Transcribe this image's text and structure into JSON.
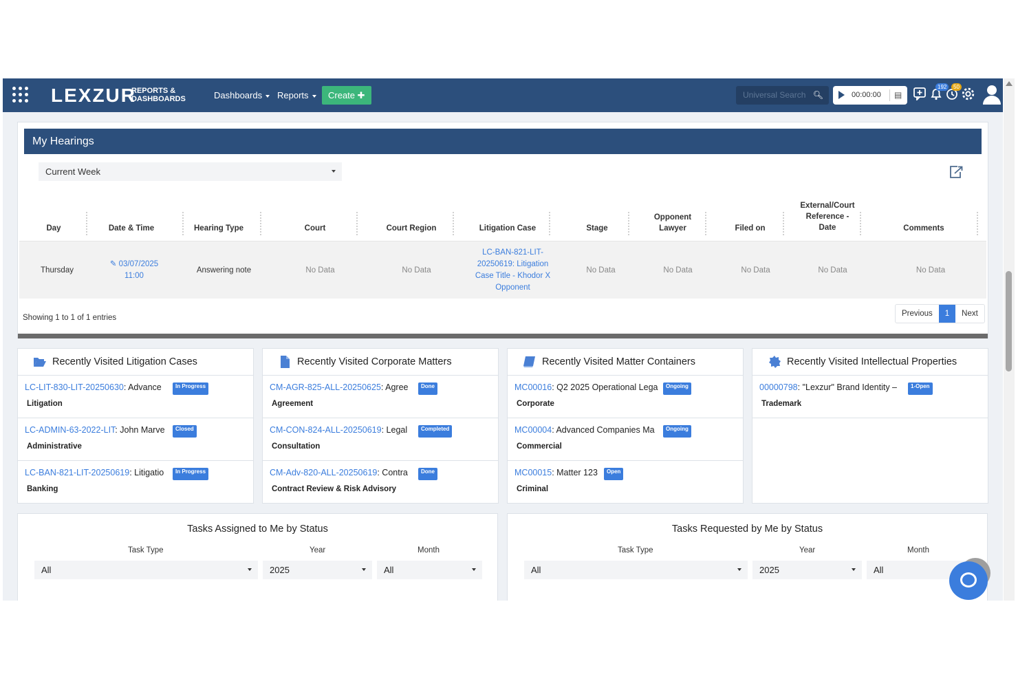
{
  "navbar": {
    "logo": "LEXZUR",
    "logo_sub_1": "REPORTS &",
    "logo_sub_2": "DASHBOARDS",
    "menu": [
      "Dashboards",
      "Reports"
    ],
    "create_label": "Create",
    "search_placeholder": "Universal Search",
    "timer": "00:00:00",
    "notifications_badge": "192",
    "reminders_badge": "50",
    "badge_colors": {
      "notifications": "#3b7ddd",
      "reminders": "#e6a817"
    }
  },
  "hearings": {
    "title": "My Hearings",
    "period": "Current Week",
    "columns": [
      "Day",
      "Date & Time",
      "Hearing Type",
      "Court",
      "Court Region",
      "Litigation Case",
      "Stage",
      "Opponent Lawyer",
      "Filed on",
      "External/Court Reference - Date",
      "Comments"
    ],
    "rows": [
      {
        "day": "Thursday",
        "date_time": "03/07/2025 11:00",
        "hearing_type": "Answering note",
        "court": "No Data",
        "court_region": "No Data",
        "litigation_case": "LC-BAN-821-LIT-20250619: Litigation Case Title - Khodor X Opponent",
        "stage": "No Data",
        "opponent_lawyer": "No Data",
        "filed_on": "No Data",
        "external_ref": "No Data",
        "comments": "No Data"
      }
    ],
    "showing": "Showing 1 to 1 of 1 entries",
    "pager": {
      "previous": "Previous",
      "current": "1",
      "next": "Next"
    }
  },
  "recent": [
    {
      "title": "Recently Visited Litigation Cases",
      "icon": "folder-open-icon",
      "items": [
        {
          "code": "LC-LIT-830-LIT-20250630",
          "text": ": Advance",
          "status": "In Progress",
          "category": "Litigation"
        },
        {
          "code": "LC-ADMIN-63-2022-LIT",
          "text": ": John Marve",
          "status": "Closed",
          "category": "Administrative"
        },
        {
          "code": "LC-BAN-821-LIT-20250619",
          "text": ": Litigatio",
          "status": "In Progress",
          "category": "Banking"
        }
      ]
    },
    {
      "title": "Recently Visited Corporate Matters",
      "icon": "file-icon",
      "items": [
        {
          "code": "CM-AGR-825-ALL-20250625",
          "text": ": Agree",
          "status": "Done",
          "category": "Agreement"
        },
        {
          "code": "CM-CON-824-ALL-20250619",
          "text": ": Legal",
          "status": "Completed",
          "category": "Consultation"
        },
        {
          "code": "CM-Adv-820-ALL-20250619",
          "text": ": Contra",
          "status": "Done",
          "category": "Contract Review & Risk Advisory"
        }
      ]
    },
    {
      "title": "Recently Visited Matter Containers",
      "icon": "book-icon",
      "items": [
        {
          "code": "MC00016",
          "text": ": Q2 2025 Operational Lega",
          "status": "Ongoing",
          "category": "Corporate"
        },
        {
          "code": "MC00004",
          "text": ": Advanced Companies Ma",
          "status": "Ongoing",
          "category": "Commercial"
        },
        {
          "code": "MC00015",
          "text": ": Matter 123",
          "status": "Open",
          "category": "Criminal"
        }
      ]
    },
    {
      "title": "Recently Visited Intellectual Properties",
      "icon": "badge-certificate-icon",
      "items": [
        {
          "code": "00000798",
          "text": ": \"Lexzur\" Brand Identity –",
          "status": "1-Open",
          "category": "Trademark"
        }
      ]
    }
  ],
  "tasks": [
    {
      "title": "Tasks Assigned to Me by Status",
      "labels": {
        "task_type": "Task Type",
        "year": "Year",
        "month": "Month"
      },
      "values": {
        "task_type": "All",
        "year": "2025",
        "month": "All"
      }
    },
    {
      "title": "Tasks Requested by Me by Status",
      "labels": {
        "task_type": "Task Type",
        "year": "Year",
        "month": "Month"
      },
      "values": {
        "task_type": "All",
        "year": "2025",
        "month": "All"
      }
    }
  ],
  "colors": {
    "navbar": "#2c4f7c",
    "accent": "#3b7ddd",
    "create": "#3cb67b"
  }
}
